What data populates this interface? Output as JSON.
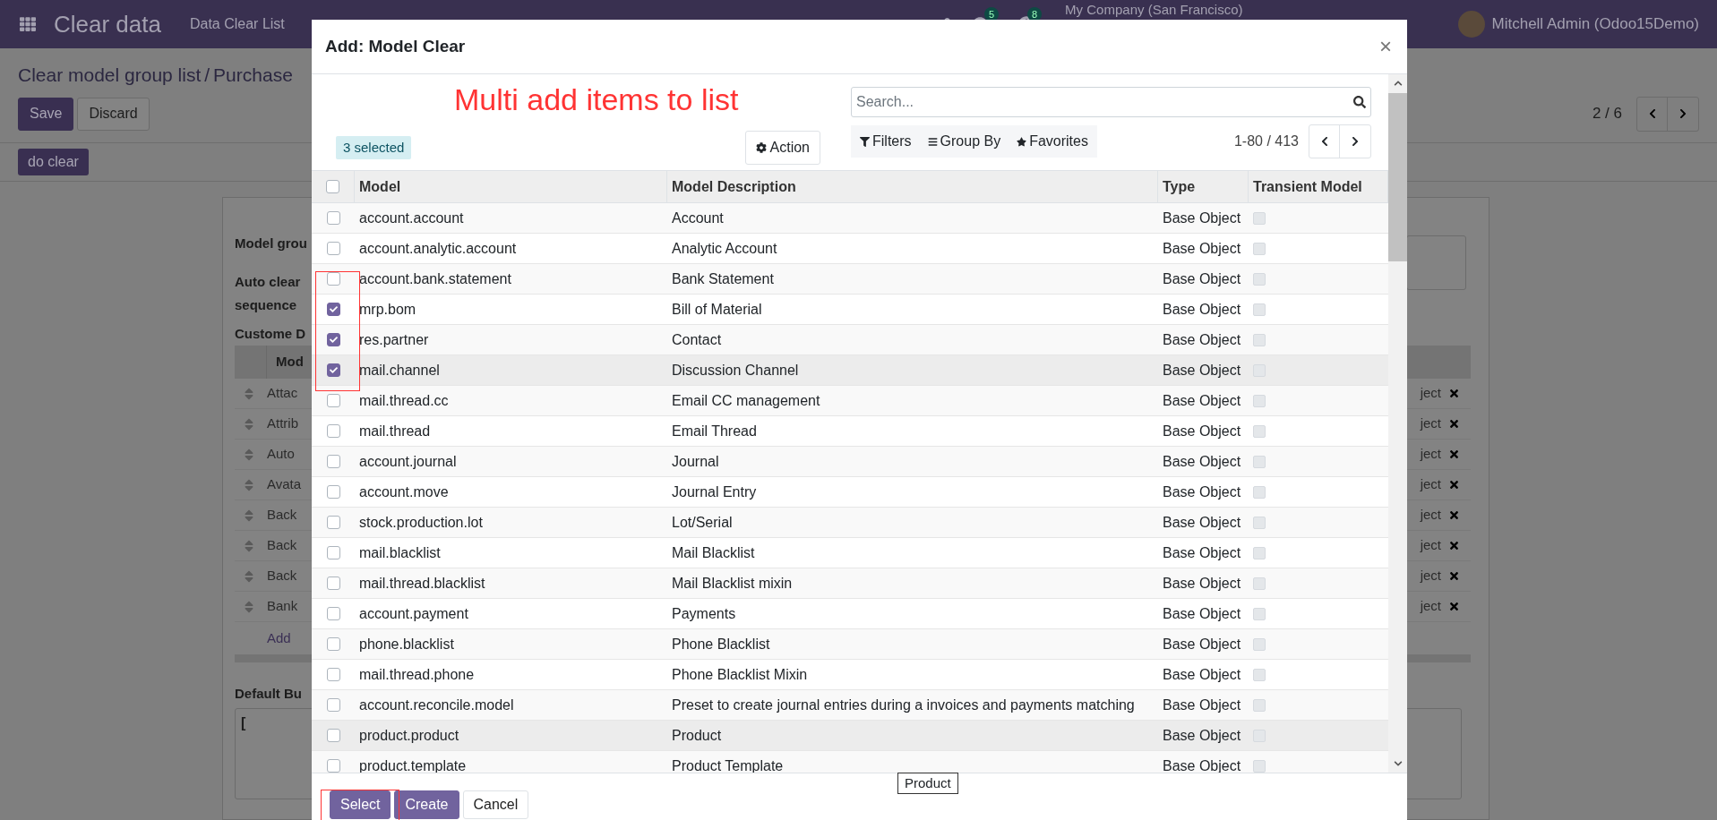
{
  "navbar": {
    "app_title": "Clear data",
    "menu": [
      "Data Clear List"
    ],
    "chat_count": "5",
    "activity_count": "8",
    "company": "My Company (San Francisco)",
    "user": "Mitchell Admin (Odoo15Demo)"
  },
  "breadcrumb": {
    "parent": "Clear model group list",
    "separator": "/",
    "current": "Purchase"
  },
  "form_buttons": [
    {
      "label": "Save",
      "kind": "primary"
    },
    {
      "label": "Discard",
      "kind": "secondary"
    }
  ],
  "record_pager": "2 / 6",
  "header_button": "do clear",
  "sheet": {
    "labels": [
      "Model grou",
      "Auto clear",
      "sequence"
    ],
    "section_title": "Custome D",
    "table_header": "Mod",
    "rows": [
      {
        "name": "Attac",
        "type": "ject"
      },
      {
        "name": "Attrib",
        "type": "ject"
      },
      {
        "name": "Auto",
        "type": "ject"
      },
      {
        "name": "Avata",
        "type": "ject"
      },
      {
        "name": "Back",
        "type": "ject"
      },
      {
        "name": "Back",
        "type": "ject"
      },
      {
        "name": "Back",
        "type": "ject"
      },
      {
        "name": "Bank",
        "type": "ject"
      }
    ],
    "add_line": "Add",
    "note_label": "Default Bu",
    "note_value": "["
  },
  "dialog": {
    "all_selected": false,
    "title": "Add: Model Clear",
    "close": "×",
    "annotation": "Multi add items to list",
    "selected_badge": "3 selected",
    "action_button": "Action",
    "search": {
      "placeholder": "Search..."
    },
    "filters": [
      "Filters",
      "Group By",
      "Favorites"
    ],
    "pager": "1-80 / 413",
    "columns": [
      "Model",
      "Model Description",
      "Type",
      "Transient Model"
    ],
    "rows": [
      {
        "model": "account.account",
        "description": "Account",
        "type": "Base Object",
        "checked": false,
        "highlighted": false,
        "transient": false
      },
      {
        "model": "account.analytic.account",
        "description": "Analytic Account",
        "type": "Base Object",
        "checked": false,
        "highlighted": false,
        "transient": false
      },
      {
        "model": "account.bank.statement",
        "description": "Bank Statement",
        "type": "Base Object",
        "checked": false,
        "highlighted": false,
        "transient": false
      },
      {
        "model": "mrp.bom",
        "description": "Bill of Material",
        "type": "Base Object",
        "checked": true,
        "highlighted": false,
        "transient": false
      },
      {
        "model": "res.partner",
        "description": "Contact",
        "type": "Base Object",
        "checked": true,
        "highlighted": false,
        "transient": false
      },
      {
        "model": "mail.channel",
        "description": "Discussion Channel",
        "type": "Base Object",
        "checked": true,
        "highlighted": true,
        "transient": false
      },
      {
        "model": "mail.thread.cc",
        "description": "Email CC management",
        "type": "Base Object",
        "checked": false,
        "highlighted": false,
        "transient": false
      },
      {
        "model": "mail.thread",
        "description": "Email Thread",
        "type": "Base Object",
        "checked": false,
        "highlighted": false,
        "transient": false
      },
      {
        "model": "account.journal",
        "description": "Journal",
        "type": "Base Object",
        "checked": false,
        "highlighted": false,
        "transient": false
      },
      {
        "model": "account.move",
        "description": "Journal Entry",
        "type": "Base Object",
        "checked": false,
        "highlighted": false,
        "transient": false
      },
      {
        "model": "stock.production.lot",
        "description": "Lot/Serial",
        "type": "Base Object",
        "checked": false,
        "highlighted": false,
        "transient": false
      },
      {
        "model": "mail.blacklist",
        "description": "Mail Blacklist",
        "type": "Base Object",
        "checked": false,
        "highlighted": false,
        "transient": false
      },
      {
        "model": "mail.thread.blacklist",
        "description": "Mail Blacklist mixin",
        "type": "Base Object",
        "checked": false,
        "highlighted": false,
        "transient": false
      },
      {
        "model": "account.payment",
        "description": "Payments",
        "type": "Base Object",
        "checked": false,
        "highlighted": false,
        "transient": false
      },
      {
        "model": "phone.blacklist",
        "description": "Phone Blacklist",
        "type": "Base Object",
        "checked": false,
        "highlighted": false,
        "transient": false
      },
      {
        "model": "mail.thread.phone",
        "description": "Phone Blacklist Mixin",
        "type": "Base Object",
        "checked": false,
        "highlighted": false,
        "transient": false
      },
      {
        "model": "account.reconcile.model",
        "description": "Preset to create journal entries during a invoices and payments matching",
        "type": "Base Object",
        "checked": false,
        "highlighted": false,
        "transient": false
      },
      {
        "model": "product.product",
        "description": "Product",
        "type": "Base Object",
        "checked": false,
        "highlighted": true,
        "transient": false
      },
      {
        "model": "product.template",
        "description": "Product Template",
        "type": "Base Object",
        "checked": false,
        "highlighted": false,
        "transient": false
      }
    ],
    "tooltip": "Product",
    "footer_buttons": [
      {
        "label": "Select",
        "kind": "primary"
      },
      {
        "label": "Create",
        "kind": "primary"
      },
      {
        "label": "Cancel",
        "kind": "secondary"
      }
    ]
  }
}
